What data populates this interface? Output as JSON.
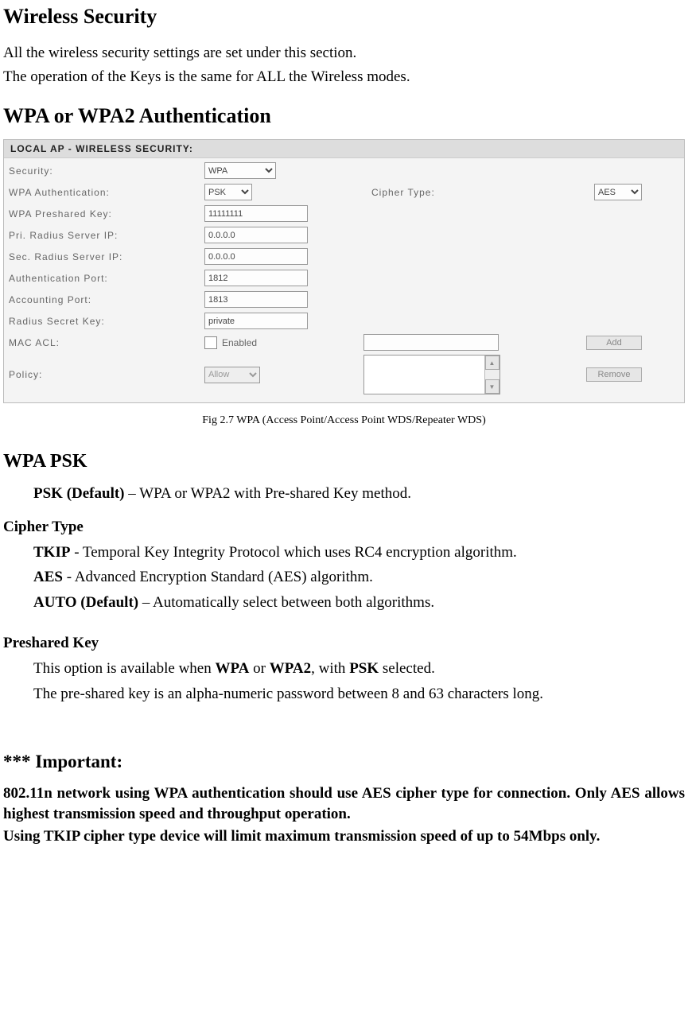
{
  "title": "Wireless Security",
  "intro1": "All the wireless security settings are set under this section.",
  "intro2": "The operation of the Keys is the same for ALL the Wireless modes.",
  "section2": "WPA or WPA2 Authentication",
  "panel": {
    "header": "LOCAL AP - WIRELESS SECURITY:",
    "security": {
      "label": "Security:",
      "value": "WPA"
    },
    "wpa_auth": {
      "label": "WPA Authentication:",
      "value": "PSK"
    },
    "cipher": {
      "label": "Cipher Type:",
      "value": "AES"
    },
    "preshared": {
      "label": "WPA Preshared Key:",
      "value": "11111111"
    },
    "priradius": {
      "label": "Pri. Radius Server IP:",
      "value": "0.0.0.0"
    },
    "secradius": {
      "label": "Sec. Radius Server IP:",
      "value": "0.0.0.0"
    },
    "authport": {
      "label": "Authentication Port:",
      "value": "1812"
    },
    "acctport": {
      "label": "Accounting Port:",
      "value": "1813"
    },
    "secretkey": {
      "label": "Radius Secret Key:",
      "value": "private"
    },
    "macacl": {
      "label": "MAC ACL:",
      "enabled_label": "Enabled",
      "add": "Add"
    },
    "policy": {
      "label": "Policy:",
      "value": "Allow",
      "remove": "Remove"
    }
  },
  "fig_caption": "Fig 2.7 WPA (Access Point/Access Point WDS/Repeater WDS)",
  "wpa_psk": {
    "heading": "WPA PSK",
    "psk_bold": "PSK (Default)",
    "psk_rest": " – WPA or WPA2 with Pre-shared Key method."
  },
  "cipher_type": {
    "heading": "Cipher Type",
    "tkip_b": "TKIP",
    "tkip_r": " - Temporal Key Integrity Protocol which uses RC4 encryption algorithm.",
    "aes_b": "AES",
    "aes_r": " - Advanced Encryption Standard (AES) algorithm.",
    "auto_b": "AUTO (Default)",
    "auto_r": " – Automatically select between both algorithms."
  },
  "preshared": {
    "heading": "Preshared Key",
    "l1a": "This option is available when ",
    "l1b": "WPA",
    "l1c": " or ",
    "l1d": "WPA2",
    "l1e": ", with ",
    "l1f": "PSK",
    "l1g": " selected.",
    "l2": "The pre-shared key is an alpha-numeric password between 8 and 63 characters long."
  },
  "important": {
    "heading": "*** Important:",
    "p1": "802.11n network using WPA authentication should use AES cipher type for connection. Only AES allows highest transmission speed and throughput operation.",
    "p2": "Using TKIP cipher type device will limit maximum transmission speed of up to 54Mbps only."
  }
}
